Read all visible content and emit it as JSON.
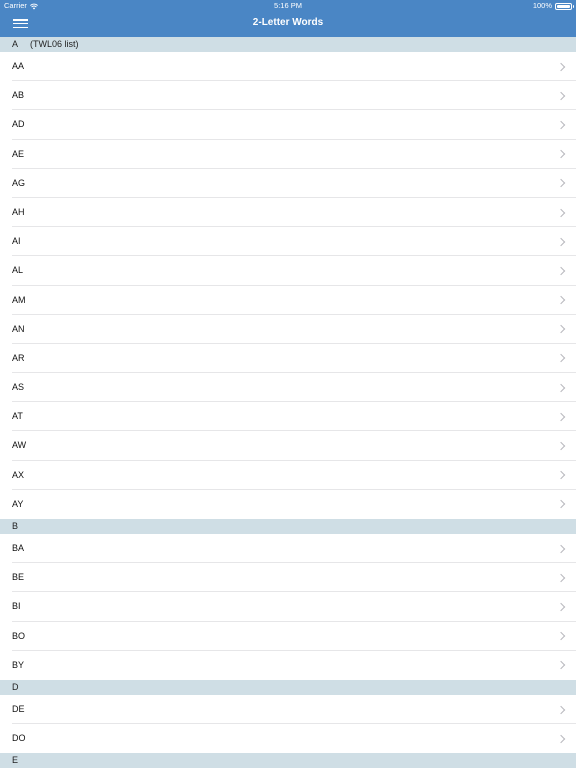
{
  "status_bar": {
    "carrier": "Carrier",
    "time": "5:16 PM",
    "battery": "100%",
    "battery_level": 1.0
  },
  "nav": {
    "title": "2-Letter Words",
    "menu_icon": "hamburger-menu-icon"
  },
  "colors": {
    "nav_bg": "#4a86c5",
    "section_bg": "#cfdee5"
  },
  "sections": [
    {
      "letter": "A",
      "note": "(TWL06 list)",
      "words": [
        "AA",
        "AB",
        "AD",
        "AE",
        "AG",
        "AH",
        "AI",
        "AL",
        "AM",
        "AN",
        "AR",
        "AS",
        "AT",
        "AW",
        "AX",
        "AY"
      ]
    },
    {
      "letter": "B",
      "note": "",
      "words": [
        "BA",
        "BE",
        "BI",
        "BO",
        "BY"
      ]
    },
    {
      "letter": "D",
      "note": "",
      "words": [
        "DE",
        "DO"
      ]
    },
    {
      "letter": "E",
      "note": "",
      "words": []
    }
  ]
}
